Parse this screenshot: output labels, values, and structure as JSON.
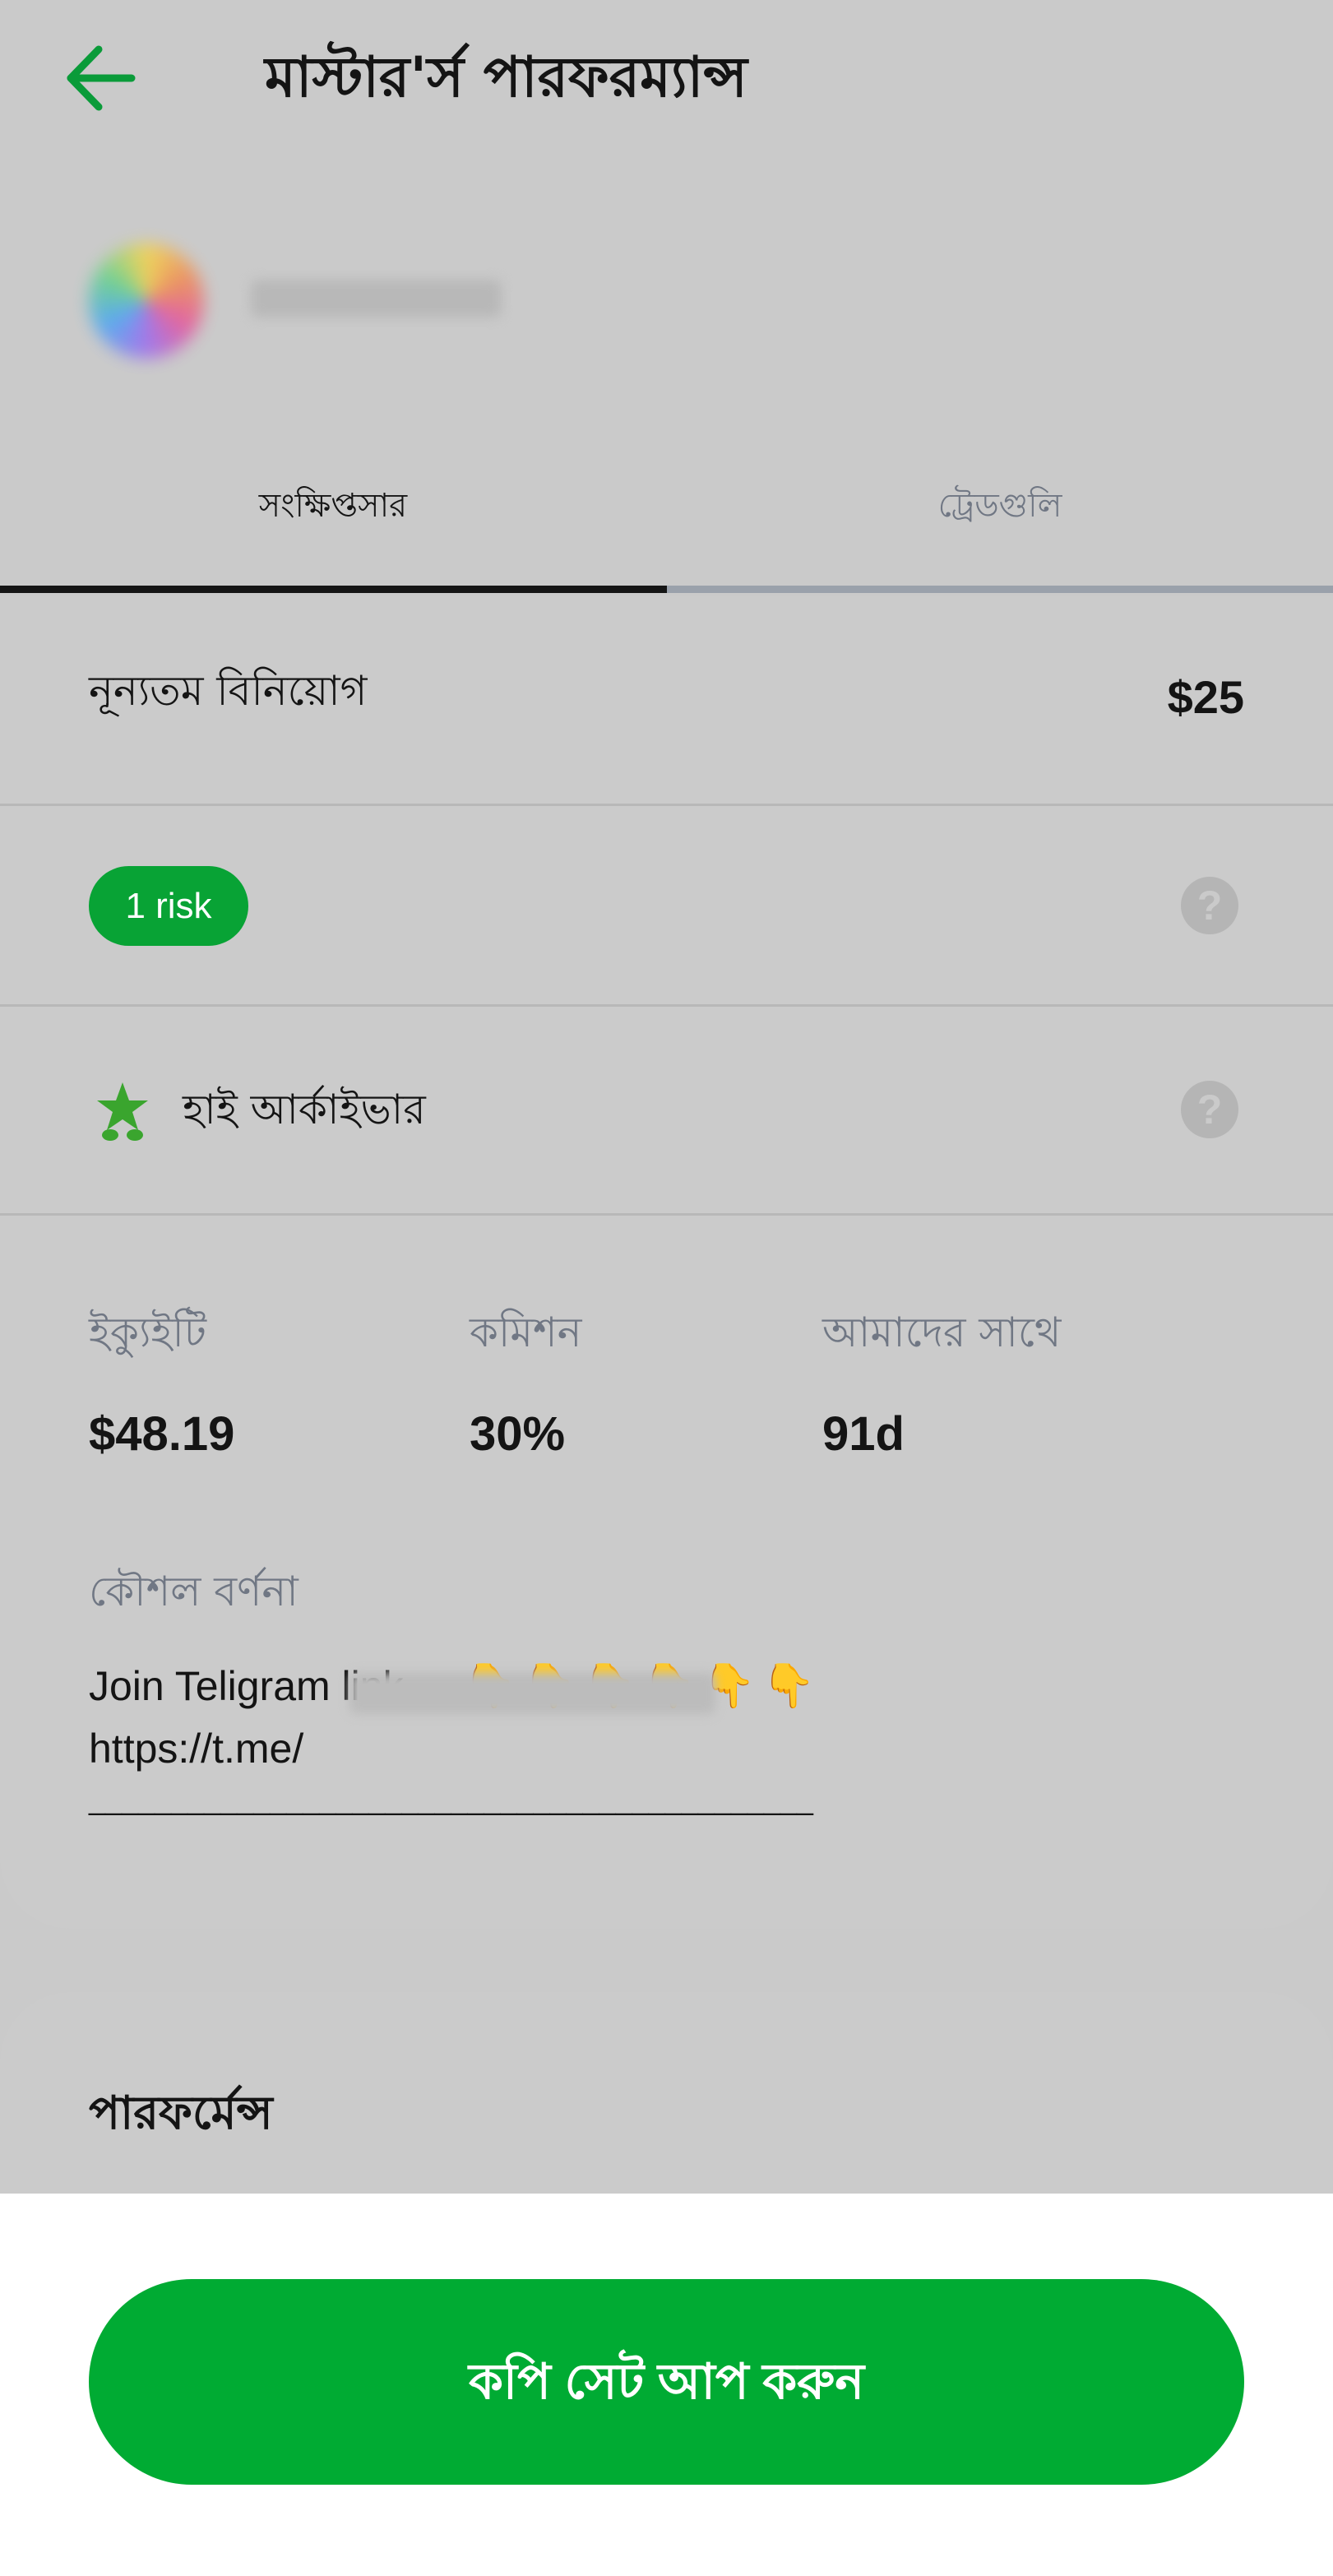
{
  "header": {
    "title": "মাস্টার'র্স পারফরম্যান্স",
    "back_icon": "arrow-left-icon",
    "accent": "#0a9b39"
  },
  "tabs": [
    {
      "label": "সংক্ষিপ্তসার",
      "active": true
    },
    {
      "label": "ট্রেডগুলি",
      "active": false
    }
  ],
  "min_investment": {
    "label": "নূন্যতম বিনিয়োগ",
    "value": "$25"
  },
  "risk": {
    "label": "1 risk",
    "color": "#08a335"
  },
  "achiever": {
    "label": "হাই আর্কাইভার",
    "icon": "star-achiever-icon"
  },
  "stats": [
    {
      "label": "ইক্যুইটি",
      "value": "$48.19"
    },
    {
      "label": "কমিশন",
      "value": "30%"
    },
    {
      "label": "আমাদের সাথে",
      "value": "91d"
    }
  ],
  "strategy": {
    "title": "কৌশল বর্ণনা",
    "line1": "Join Teligram link",
    "emoji": [
      "👇",
      "👇",
      "👇",
      "👇",
      "👇",
      "👇"
    ],
    "line2": "https://t.me/",
    "line3": "____________________________________________"
  },
  "performance": {
    "title": "পারফর্মেন্স"
  },
  "copy_button": {
    "label": "কপি সেট আপ করুন",
    "color": "#00ab33"
  }
}
